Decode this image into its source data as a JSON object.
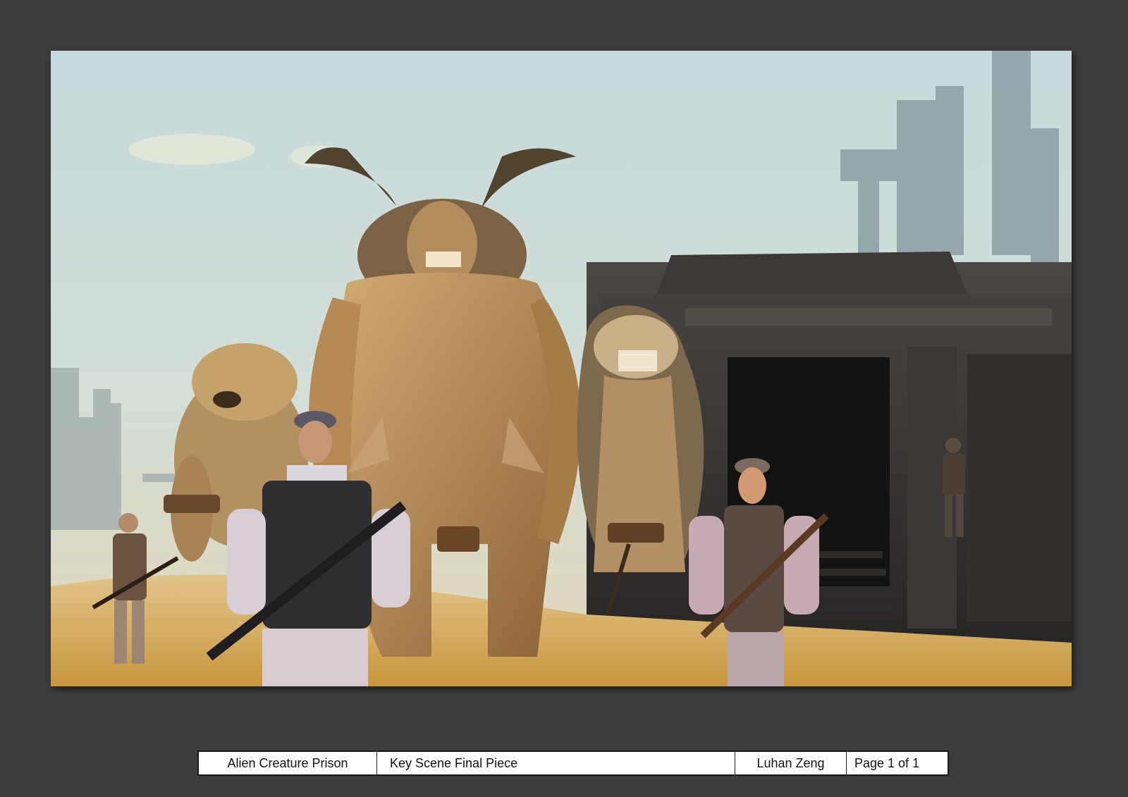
{
  "artwork": {
    "subject": "alien-creature-prison-key-scene-painting"
  },
  "title_block": {
    "project": "Alien Creature Prison",
    "description": "Key Scene Final Piece",
    "artist": "Luhan Zeng",
    "page": "Page 1 of 1"
  },
  "colors": {
    "background": "#3c3c3c",
    "sky": "#c9dcdc",
    "sand": "#d7b06a",
    "building": "#2f2d2c",
    "creature": "#b98f5c"
  }
}
